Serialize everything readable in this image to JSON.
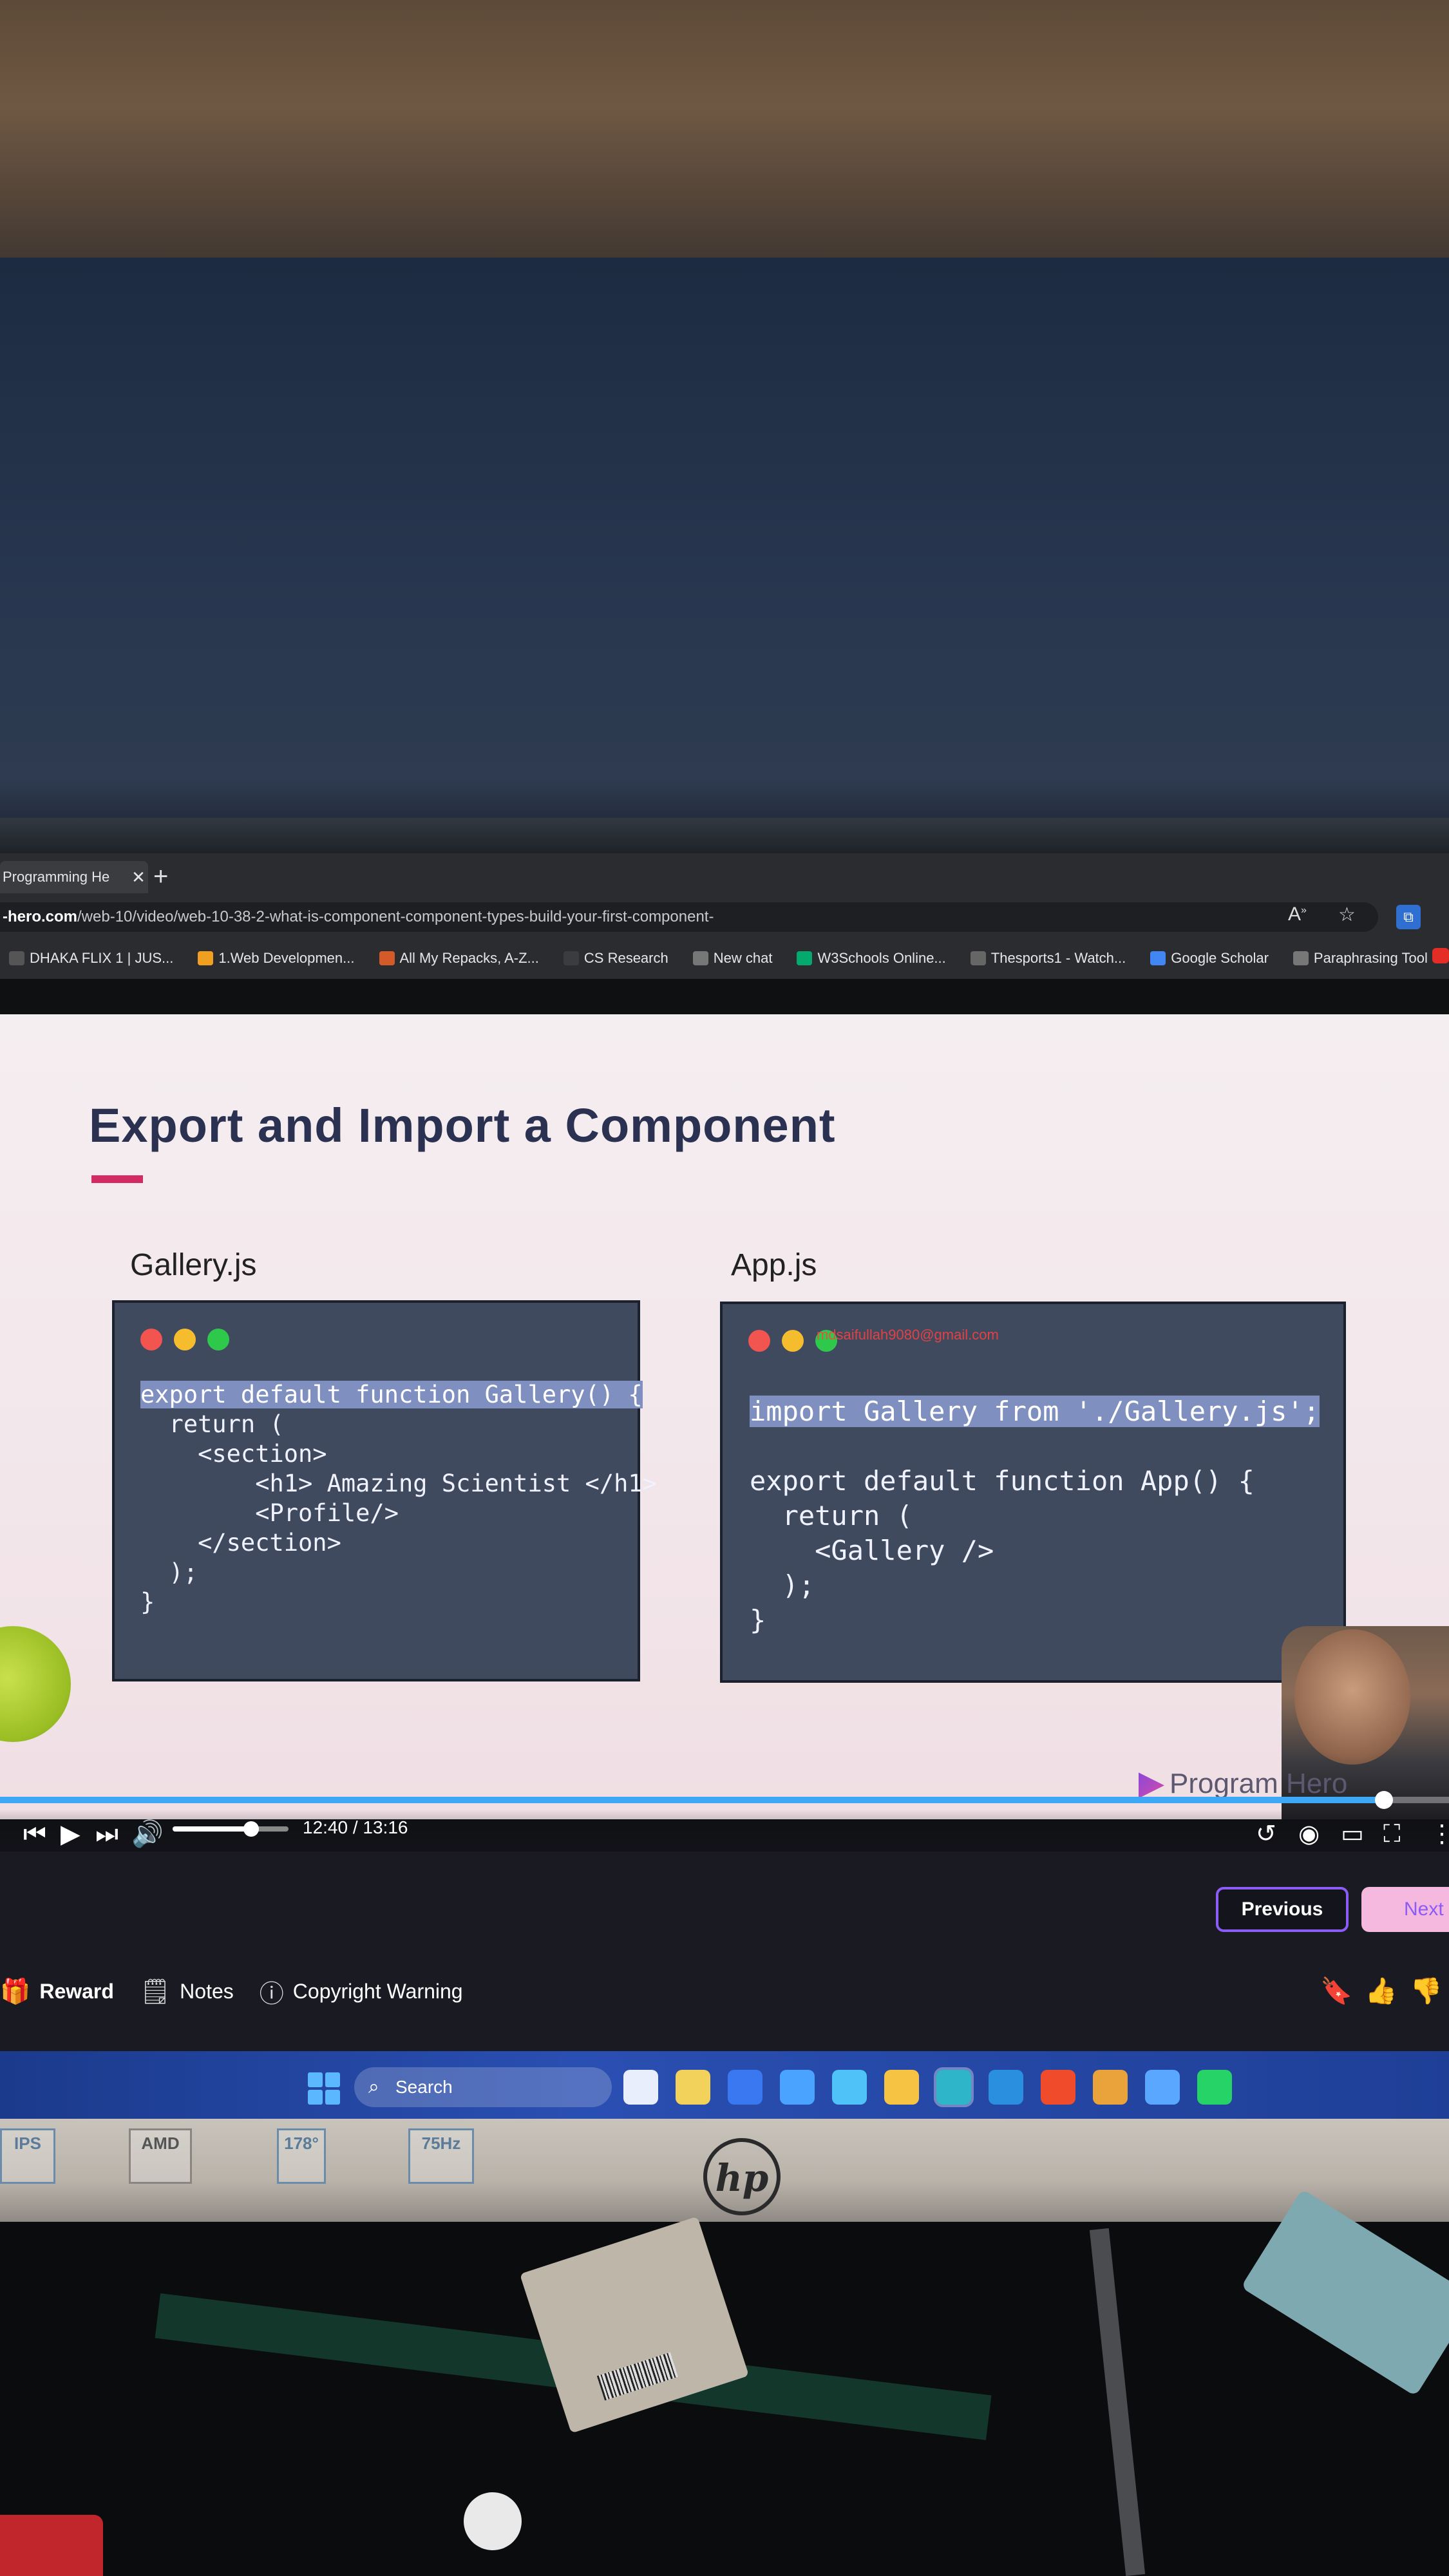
{
  "browser": {
    "tab_title": "Programming He",
    "tab_close": "✕",
    "new_tab": "+",
    "url_host": "-hero.com",
    "url_path": "/web-10/video/web-10-38-2-what-is-component-component-types-build-your-first-component-",
    "bookmarks": [
      {
        "label": "DHAKA FLIX 1 | JUS...",
        "icon": "dhaka-flix-icon",
        "color": "#555555"
      },
      {
        "label": "1.Web Developmen...",
        "icon": "web-dev-icon",
        "color": "#f0a020"
      },
      {
        "label": "All My Repacks, A-Z...",
        "icon": "repacks-icon",
        "color": "#d45a2a"
      },
      {
        "label": "CS Research",
        "icon": "document-icon",
        "color": "#3b3c40"
      },
      {
        "label": "New chat",
        "icon": "chatgpt-icon",
        "color": "#777777"
      },
      {
        "label": "W3Schools Online...",
        "icon": "w3schools-icon",
        "color": "#04aa6d"
      },
      {
        "label": "Thesports1 - Watch...",
        "icon": "thesports-icon",
        "color": "#666666"
      },
      {
        "label": "Google Scholar",
        "icon": "google-icon",
        "color": "#4285f4"
      },
      {
        "label": "Paraphrasing Tool -...",
        "icon": "quillbot-icon",
        "color": "#777777"
      }
    ]
  },
  "slide": {
    "title": "Export and Import a Component",
    "accent_color": "#d22b63",
    "left": {
      "filename": "Gallery.js",
      "code": [
        {
          "text": "export default function Gallery() {",
          "highlight": true
        },
        {
          "text": "  return (",
          "highlight": false
        },
        {
          "text": "    <section>",
          "highlight": false
        },
        {
          "text": "        <h1> Amazing Scientist </h1>",
          "highlight": false
        },
        {
          "text": "        <Profile/>",
          "highlight": false
        },
        {
          "text": "    </section>",
          "highlight": false
        },
        {
          "text": "  );",
          "highlight": false
        },
        {
          "text": "}",
          "highlight": false
        }
      ]
    },
    "right": {
      "filename": "App.js",
      "watermark": "mdsaifullah9080@gmail.com",
      "code": [
        {
          "text": "import Gallery from './Gallery.js';",
          "highlight": true
        },
        {
          "text": "",
          "highlight": false
        },
        {
          "text": "export default function App() {",
          "highlight": false
        },
        {
          "text": "  return (",
          "highlight": false
        },
        {
          "text": "    <Gallery />",
          "highlight": false
        },
        {
          "text": "  );",
          "highlight": false
        },
        {
          "text": "}",
          "highlight": false
        }
      ]
    },
    "brand": "Program  Hero"
  },
  "player": {
    "time": "12:40 / 13:16",
    "progress": 0.955,
    "volume": 0.68,
    "accent": "#3da8f5"
  },
  "lesson_nav": {
    "previous_label": "Previous",
    "next_label": "Next"
  },
  "actions": [
    {
      "label": "Reward",
      "icon": "gift-icon"
    },
    {
      "label": "Notes",
      "icon": "notes-icon"
    },
    {
      "label": "Copyright Warning",
      "icon": "info-icon"
    }
  ],
  "taskbar": {
    "search_label": "Search",
    "apps": [
      "task-view-icon",
      "file-icon",
      "store-icon",
      "calculator-icon",
      "widgets-icon",
      "file-explorer-icon",
      "edge-icon",
      "vscode-icon",
      "brave-icon",
      "chrome-icon",
      "browser-icon",
      "whatsapp-icon"
    ]
  },
  "bezel": {
    "logo": "hp",
    "stickers": [
      "IPS",
      "AMD",
      "178°",
      "75Hz"
    ]
  }
}
